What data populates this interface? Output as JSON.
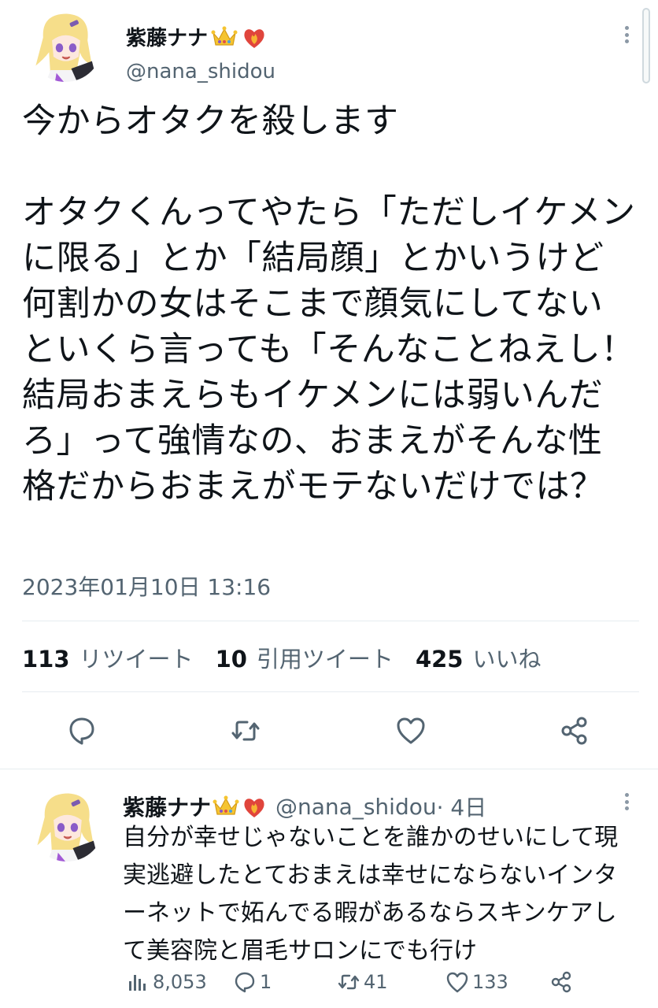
{
  "main_tweet": {
    "display_name": "紫藤ナナ",
    "handle": "@nana_shidou",
    "text": "今からオタクを殺します\n\nオタクくんってやたら「ただしイケメンに限る」とか「結局顔」とかいうけど何割かの女はそこまで顔気にしてないといくら言っても「そんなことねえし！結局おまえらもイケメンには弱いんだろ」って強情なの、おまえがそんな性格だからおまえがモテないだけでは？",
    "date": "2023年01月10日 13:16",
    "stats": {
      "retweets_count": "113",
      "retweets_label": "リツイート",
      "quotes_count": "10",
      "quotes_label": "引用ツイート",
      "likes_count": "425",
      "likes_label": "いいね"
    }
  },
  "reply_tweet": {
    "display_name": "紫藤ナナ",
    "handle": "@nana_shidou",
    "time": " · 4日",
    "text": "自分が幸せじゃないことを誰かのせいにして現実逃避したとておまえは幸せにならないインターネットで妬んでる暇があるならスキンケアして美容院と眉毛サロンにでも行け",
    "metrics": {
      "views": "8,053",
      "replies": "1",
      "retweets": "41",
      "likes": "133"
    }
  },
  "icons": [
    "crown-emoji",
    "fire-heart-emoji",
    "more-icon",
    "reply-icon",
    "retweet-icon",
    "like-icon",
    "share-icon",
    "views-icon"
  ],
  "colors": {
    "text_primary": "#0f1419",
    "text_secondary": "#536471",
    "divider": "#e6ecf0"
  }
}
